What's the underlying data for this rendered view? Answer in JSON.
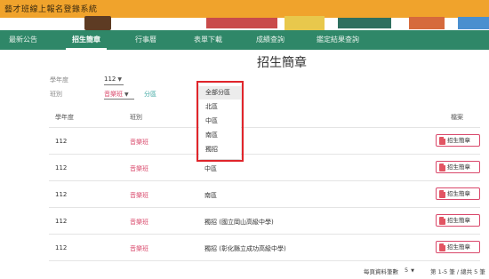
{
  "app": {
    "title": "藝才班線上報名登錄系統"
  },
  "nav": {
    "items": [
      {
        "label": "最新公告"
      },
      {
        "label": "招生簡章"
      },
      {
        "label": "行事曆"
      },
      {
        "label": "表單下載"
      },
      {
        "label": "成績查詢"
      },
      {
        "label": "鑑定結果查詢"
      }
    ],
    "active": "招生簡章"
  },
  "page": {
    "title": "招生簡章"
  },
  "filters": {
    "year_label": "學年度",
    "year_value": "112",
    "category_label": "班別",
    "category_value": "音樂班",
    "district_label": "分區",
    "district_options": [
      "全部分區",
      "北區",
      "中區",
      "南區",
      "獨招"
    ],
    "district_selected": "全部分區"
  },
  "table": {
    "headers": {
      "year": "學年度",
      "class": "班別",
      "district": "",
      "file": "檔案"
    },
    "rows": [
      {
        "year": "112",
        "class": "音樂班",
        "district": "",
        "file": "招生簡章"
      },
      {
        "year": "112",
        "class": "音樂班",
        "district": "中區",
        "file": "招生簡章"
      },
      {
        "year": "112",
        "class": "音樂班",
        "district": "南區",
        "file": "招生簡章"
      },
      {
        "year": "112",
        "class": "音樂班",
        "district": "獨招 (國立岡山高級中學)",
        "file": "招生簡章"
      },
      {
        "year": "112",
        "class": "音樂班",
        "district": "獨招 (彰化縣立成功高級中學)",
        "file": "招生簡章"
      }
    ]
  },
  "pagination": {
    "per_page_label": "每頁資料筆數",
    "per_page_value": "5",
    "range_text": "第 1-5 筆 / 總共 5 筆"
  },
  "colors": {
    "header": "#f0a32c",
    "nav": "#2f8768",
    "accent": "#d9486b",
    "highlight": "#e0252b"
  }
}
